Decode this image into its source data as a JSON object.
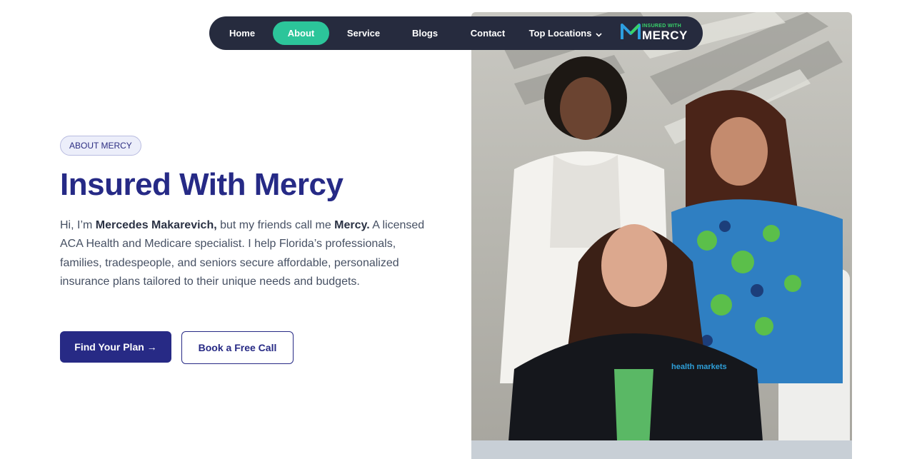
{
  "nav": {
    "items": [
      {
        "label": "Home"
      },
      {
        "label": "About"
      },
      {
        "label": "Service"
      },
      {
        "label": "Blogs"
      },
      {
        "label": "Contact"
      },
      {
        "label": "Top Locations"
      }
    ],
    "active": "About",
    "logo": {
      "top_text": "INSURED WITH",
      "bottom_text": "MERCY",
      "mark": "M"
    }
  },
  "hero": {
    "badge": "ABOUT MERCY",
    "title": "Insured With Mercy",
    "description": {
      "intro": "Hi, I’m ",
      "name": "Mercedes Makarevich,",
      "middle": " but my friends call me ",
      "nickname": "Mercy.",
      "rest": " A licensed ACA Health and Medicare specialist. I help Florida’s professionals, families, tradespeople, and seniors secure affordable, personalized insurance plans tailored to their unique needs and budgets."
    },
    "primary_button": "Find Your Plan →",
    "secondary_button": "Book a Free Call"
  },
  "photo": {
    "alt_semantic": "team-photo",
    "shirt_text": "health markets"
  },
  "colors": {
    "accent": "#2cc59a",
    "brand": "#262a86",
    "nav_bg": "#262b3e"
  }
}
